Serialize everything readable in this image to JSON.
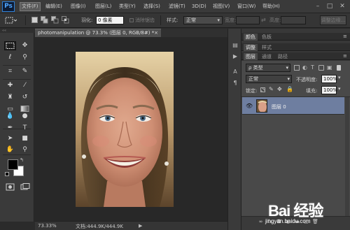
{
  "app": {
    "logo": "Ps"
  },
  "menu": [
    "文件(F)",
    "编辑(E)",
    "图像(I)",
    "图层(L)",
    "类型(Y)",
    "选择(S)",
    "滤镜(T)",
    "3D(D)",
    "视图(V)",
    "窗口(W)",
    "帮助(H)"
  ],
  "window_controls": {
    "minimize": "–",
    "maximize": "□",
    "close": "✕"
  },
  "options": {
    "feather_label": "羽化:",
    "feather_value": "0 像素",
    "antialias_label": "消除锯齿",
    "style_label": "样式:",
    "style_value": "正常",
    "width_label": "宽度:",
    "height_label": "高度:",
    "refine_edge_button": "调整边缘..."
  },
  "document": {
    "tab_title": "photomanipulation @ 73.3% (图层 0, RGB/8#) *",
    "close": "×",
    "zoom": "73.33%",
    "doc_size": "文档:444.9K/444.9K"
  },
  "colors": {
    "foreground": "#000000",
    "background": "#ffffff",
    "accent_selected_layer": "#6e7ea0"
  },
  "panels": {
    "top_tabs": [
      "颜色",
      "色板"
    ],
    "mid_tabs": [
      "调整",
      "样式"
    ],
    "lower_tabs": [
      "图层",
      "通道",
      "路径"
    ],
    "layers": {
      "filter_label": "ρ 类型",
      "blend_mode": "正常",
      "opacity_label": "不透明度:",
      "opacity_value": "100%",
      "lock_label": "锁定:",
      "fill_label": "填充:",
      "fill_value": "100%",
      "items": [
        {
          "name": "图层 0",
          "visible": true
        }
      ]
    }
  },
  "watermark": {
    "logo": "Bai 经验",
    "url": "jingyan.baidu.com"
  }
}
